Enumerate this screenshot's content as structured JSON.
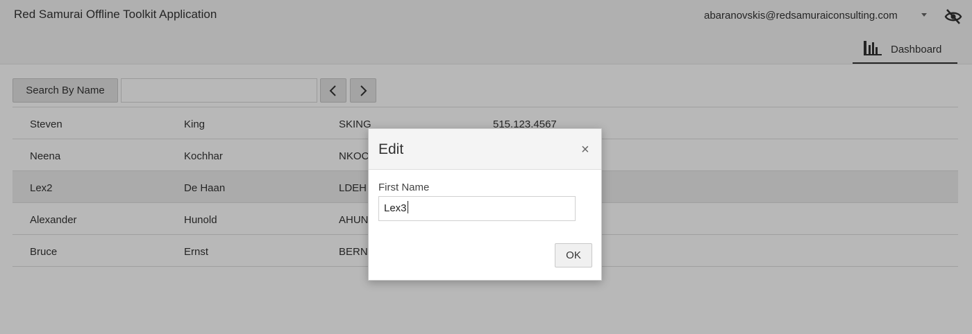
{
  "header": {
    "app_title": "Red Samurai Offline Toolkit Application",
    "user_email": "abaranovskis@redsamuraiconsulting.com",
    "nav_tab": "Dashboard"
  },
  "toolbar": {
    "search_button": "Search By Name",
    "search_value": "",
    "prev_icon": "chevron-left-icon",
    "next_icon": "chevron-right-icon"
  },
  "table": {
    "rows": [
      {
        "first": "Steven",
        "last": "King",
        "email": "SKING",
        "phone": "515.123.4567"
      },
      {
        "first": "Neena",
        "last": "Kochhar",
        "email": "NKOC",
        "phone": ""
      },
      {
        "first": "Lex2",
        "last": "De Haan",
        "email": "LDEH",
        "phone": "",
        "selected": true
      },
      {
        "first": "Alexander",
        "last": "Hunold",
        "email": "AHUN",
        "phone": ""
      },
      {
        "first": "Bruce",
        "last": "Ernst",
        "email": "BERN",
        "phone": ""
      }
    ]
  },
  "dialog": {
    "title": "Edit",
    "close_label": "×",
    "field_label": "First Name",
    "field_value": "Lex3",
    "ok_label": "OK"
  },
  "colors": {
    "overlay": "rgba(0,0,0,0.28)",
    "header_bg": "#f4f4f4",
    "selected_row": "#eeeeee"
  }
}
